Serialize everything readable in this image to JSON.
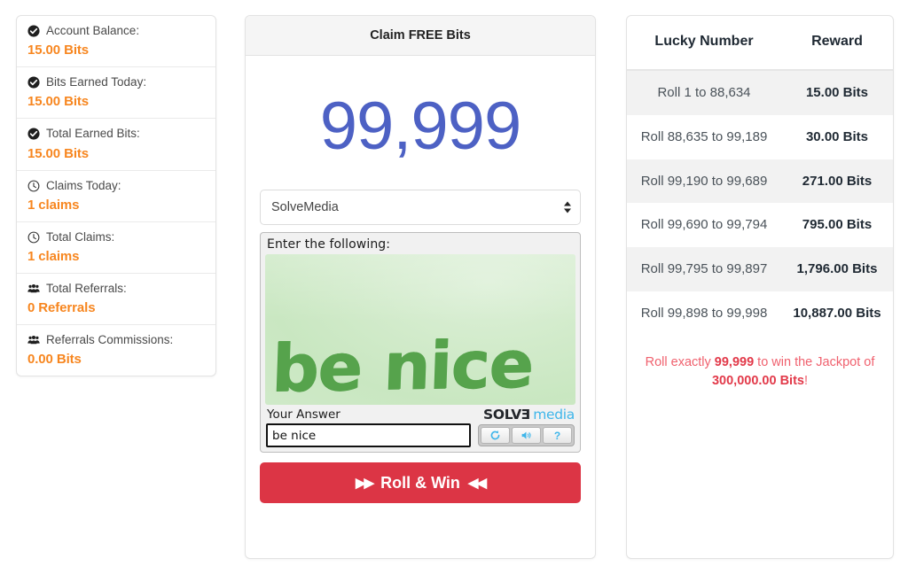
{
  "stats": {
    "items": [
      {
        "icon": "check-circle-icon",
        "label": "Account Balance:",
        "value": "15.00 Bits"
      },
      {
        "icon": "check-circle-icon",
        "label": "Bits Earned Today:",
        "value": "15.00 Bits"
      },
      {
        "icon": "check-circle-icon",
        "label": "Total Earned Bits:",
        "value": "15.00 Bits"
      },
      {
        "icon": "clock-icon",
        "label": "Claims Today:",
        "value": "1 claims"
      },
      {
        "icon": "clock-icon",
        "label": "Total Claims:",
        "value": "1 claims"
      },
      {
        "icon": "users-icon",
        "label": "Total Referrals:",
        "value": "0 Referrals"
      },
      {
        "icon": "users-icon",
        "label": "Referrals Commissions:",
        "value": "0.00 Bits"
      }
    ],
    "value_color": "#f7861f"
  },
  "claim": {
    "title": "Claim FREE Bits",
    "lucky_number": "99,999",
    "lucky_number_color": "#4d61c4",
    "captcha_provider": {
      "selected": "SolveMedia",
      "options": [
        "SolveMedia"
      ]
    },
    "captcha": {
      "prompt": "Enter the following:",
      "challenge_text": "be nice",
      "answer_label": "Your Answer",
      "answer_value": "be nice",
      "answer_placeholder": "",
      "brand_solve": "SOLV",
      "brand_solve_reversed_letter": "E",
      "brand_media": "media",
      "buttons": [
        {
          "name": "refresh-icon",
          "glyph": "↻"
        },
        {
          "name": "audio-icon",
          "glyph": "🔊"
        },
        {
          "name": "help-icon",
          "glyph": "?"
        }
      ]
    },
    "roll_button": {
      "label": "Roll & Win",
      "left_glyph": "▶▶",
      "right_glyph": "◀◀",
      "color": "#dc3545"
    }
  },
  "rewards": {
    "columns": [
      "Lucky Number",
      "Reward"
    ],
    "rows": [
      {
        "range": "Roll 1 to 88,634",
        "reward": "15.00 Bits"
      },
      {
        "range": "Roll 88,635 to 99,189",
        "reward": "30.00 Bits"
      },
      {
        "range": "Roll 99,190 to 99,689",
        "reward": "271.00 Bits"
      },
      {
        "range": "Roll 99,690 to 99,794",
        "reward": "795.00 Bits"
      },
      {
        "range": "Roll 99,795 to 99,897",
        "reward": "1,796.00 Bits"
      },
      {
        "range": "Roll 99,898 to 99,998",
        "reward": "10,887.00 Bits"
      }
    ],
    "jackpot": {
      "prefix": "Roll exactly ",
      "number": "99,999",
      "middle": " to win the Jackpot of ",
      "amount": "300,000.00 Bits",
      "suffix": "!",
      "color": "#f0616e"
    }
  }
}
